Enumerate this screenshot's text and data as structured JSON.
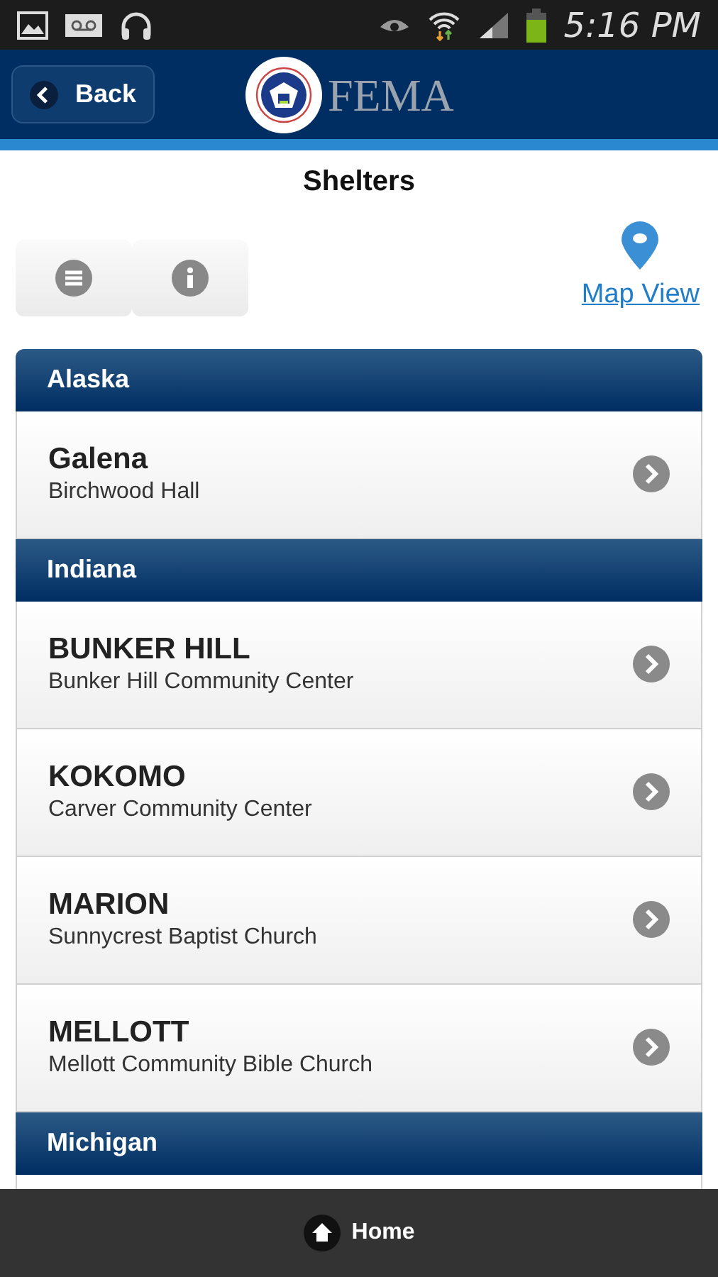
{
  "status_bar": {
    "time": "5:16 PM"
  },
  "header": {
    "back_label": "Back",
    "logo_text": "FEMA"
  },
  "page_title": "Shelters",
  "toolbar": {
    "map_link": "Map View"
  },
  "groups": [
    {
      "state": "Alaska",
      "shelters": [
        {
          "city": "Galena",
          "place": "Birchwood Hall"
        }
      ]
    },
    {
      "state": "Indiana",
      "shelters": [
        {
          "city": "BUNKER HILL",
          "place": "Bunker Hill Community Center"
        },
        {
          "city": "KOKOMO",
          "place": "Carver Community Center"
        },
        {
          "city": "MARION",
          "place": "Sunnycrest Baptist Church"
        },
        {
          "city": "MELLOTT",
          "place": "Mellott Community Bible Church"
        }
      ]
    },
    {
      "state": "Michigan"
    }
  ],
  "footer": {
    "home_label": "Home"
  }
}
